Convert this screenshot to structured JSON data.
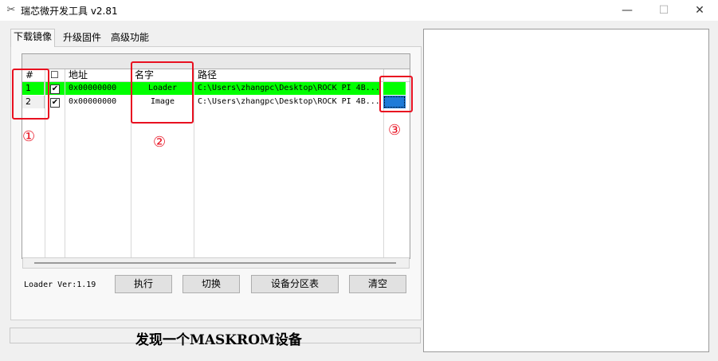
{
  "window": {
    "title": "瑞芯微开发工具 v2.81",
    "icon": "crossed-tools-icon",
    "controls": [
      "—",
      "☐",
      "✕"
    ]
  },
  "tabs": [
    {
      "label": "下载镜像",
      "active": true
    },
    {
      "label": "升级固件",
      "active": false
    },
    {
      "label": "高级功能",
      "active": false
    }
  ],
  "table": {
    "headers": [
      "#",
      "☐",
      "地址",
      "名字",
      "路径"
    ],
    "rows": [
      {
        "num": "1",
        "checked": "✔",
        "address": "0x00000000",
        "name": "Loader",
        "path": "C:\\Users\\zhangpc\\Desktop\\ROCK PI 4B...",
        "color": "#00ff00",
        "selector_color": "#00ff00"
      },
      {
        "num": "2",
        "checked": "✔",
        "address": "0x00000000",
        "name": "Image",
        "path": "C:\\Users\\zhangpc\\Desktop\\ROCK PI 4B...",
        "color": "#ffffff",
        "selector_color": "#1e7bd8"
      }
    ]
  },
  "loader_version": "Loader Ver:1.19",
  "buttons": {
    "execute": "执行",
    "switch": "切换",
    "partition_table": "设备分区表",
    "clear": "清空"
  },
  "status": "发现一个MASKROM设备",
  "annotations": [
    "①",
    "②",
    "③"
  ],
  "annotation_color": "#e81020"
}
